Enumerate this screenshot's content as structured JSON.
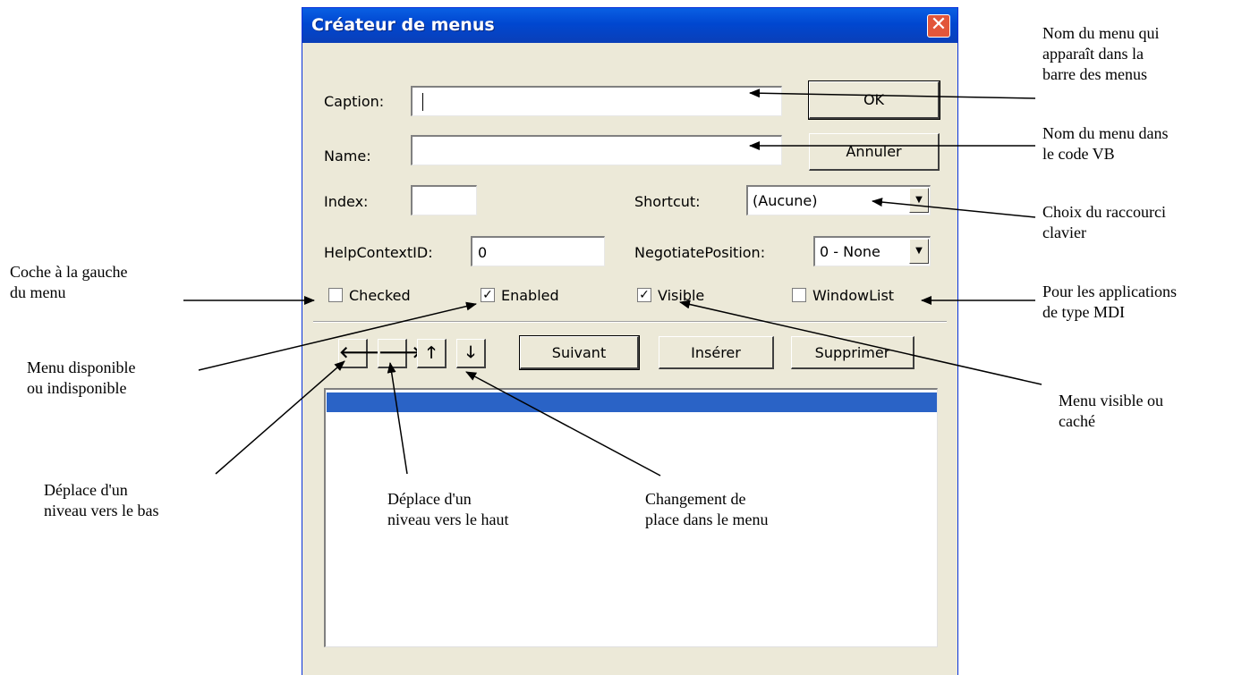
{
  "dialog": {
    "title": "Créateur de menus",
    "close_glyph": "✕",
    "caption_label": "Caption:",
    "caption_value": "",
    "name_label": "Name:",
    "name_value": "",
    "index_label": "Index:",
    "index_value": "",
    "helpcontext_label": "HelpContextID:",
    "helpcontext_value": "0",
    "shortcut_label": "Shortcut:",
    "shortcut_value": "(Aucune)",
    "negotiate_label": "NegotiatePosition:",
    "negotiate_value": "0 - None",
    "ok_label": "OK",
    "cancel_label": "Annuler",
    "checkboxes": {
      "checked": {
        "label": "Checked",
        "state": false
      },
      "enabled": {
        "label": "Enabled",
        "state": true
      },
      "visible": {
        "label": "Visible",
        "state": true
      },
      "windowlist": {
        "label": "WindowList",
        "state": false
      }
    },
    "arrows": {
      "left": "🡐",
      "right": "🡒",
      "up": "🡑",
      "down": "🡓"
    },
    "next_label": "Suivant",
    "insert_label": "Insérer",
    "delete_label": "Supprimer",
    "colors": {
      "titlebar": "#0047d0",
      "selection": "#2a63c6",
      "face": "#ece9d8",
      "close": "#e2563a"
    }
  },
  "annotations": {
    "menu_name": "Nom du menu qui\napparaît dans la\nbarre des menus",
    "code_name": "Nom du menu dans\nle code VB",
    "shortcut": "Choix du raccourci\nclavier",
    "mdi": "Pour les applications\nde type MDI",
    "checked": "Coche à la gauche\ndu menu",
    "enabled": "Menu disponible\nou indisponible",
    "visible": "Menu visible ou\ncaché",
    "level_down": "Déplace d'un\nniveau vers le bas",
    "level_up": "Déplace d'un\nniveau vers le haut",
    "order": "Changement de\nplace dans le menu"
  }
}
